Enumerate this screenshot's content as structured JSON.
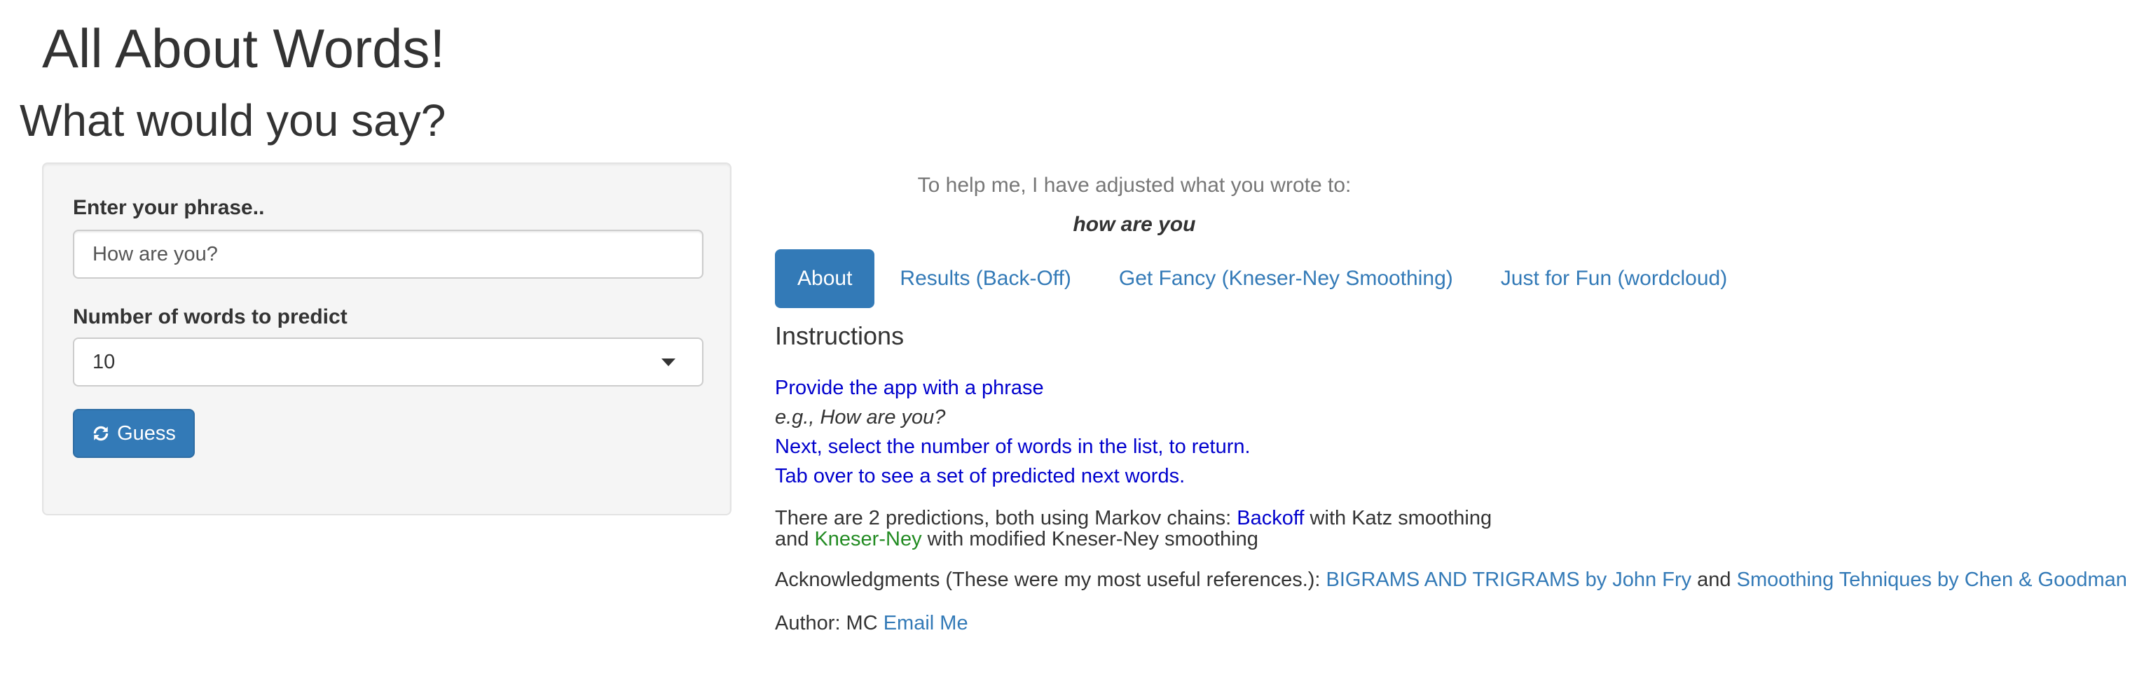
{
  "header": {
    "title": "All About Words!",
    "subtitle": "What would you say?"
  },
  "sidebar": {
    "phrase_label": "Enter your phrase..",
    "phrase_value": "How are you?",
    "count_label": "Number of words to predict",
    "count_selected": "10",
    "guess_button": "Guess"
  },
  "main": {
    "adjusted_intro": "To help me, I have adjusted what you wrote to:",
    "adjusted_value": "how are you",
    "tabs": [
      {
        "label": "About",
        "active": true
      },
      {
        "label": "Results (Back-Off)",
        "active": false
      },
      {
        "label": "Get Fancy (Kneser-Ney Smoothing)",
        "active": false
      },
      {
        "label": "Just for Fun (wordcloud)",
        "active": false
      }
    ],
    "about": {
      "heading": "Instructions",
      "step1": "Provide the app with a phrase",
      "example": "e.g., How are you?",
      "step2": "Next, select the number of words in the list, to return.",
      "step3": "Tab over to see a set of predicted next words.",
      "predictions_prefix": "There are 2 predictions, both using Markov chains: ",
      "backoff_label": "Backoff",
      "backoff_suffix": " with Katz smoothing",
      "and_prefix": "and ",
      "kneser_label": "Kneser-Ney",
      "kneser_suffix": " with modified Kneser-Ney smoothing",
      "ack_prefix": "Acknowledgments (These were my most useful references.): ",
      "ref1": "BIGRAMS AND TRIGRAMS by John Fry",
      "ack_and": " and ",
      "ref2": "Smoothing Tehniques by Chen & Goodman",
      "author_prefix": "Author: MC ",
      "email_link": "Email Me"
    }
  },
  "colors": {
    "primary": "#337ab7",
    "instruction_blue": "#0000cd",
    "kneser_green": "#228b22"
  },
  "icons": {
    "guess": "refresh-icon",
    "select": "caret-down-icon"
  }
}
